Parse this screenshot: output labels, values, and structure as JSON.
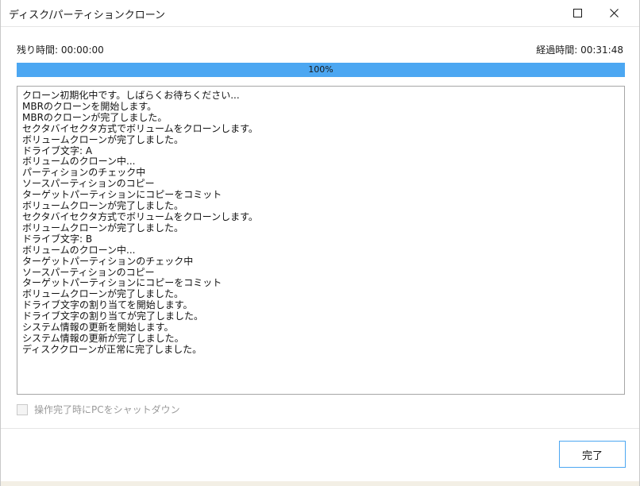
{
  "window": {
    "title": "ディスク/パーティションクローン",
    "maximize_icon": "maximize-icon",
    "close_icon": "close-icon"
  },
  "times": {
    "remaining": "残り時間:  00:00:00",
    "elapsed": "経過時間:  00:31:48"
  },
  "progress": {
    "percent": 100,
    "label": "100%",
    "color": "#4ca7f2"
  },
  "log": {
    "lines": [
      "クローン初期化中です。しばらくお待ちください...",
      "MBRのクローンを開始します。",
      "MBRのクローンが完了しました。",
      "セクタバイセクタ方式でボリュームをクローンします。",
      "ボリュームクローンが完了しました。",
      "ドライブ文字: A",
      "ボリュームのクローン中...",
      "パーティションのチェック中",
      "ソースパーティションのコピー",
      "ターゲットパーティションにコピーをコミット",
      "ボリュームクローンが完了しました。",
      "セクタバイセクタ方式でボリュームをクローンします。",
      "ボリュームクローンが完了しました。",
      "ドライブ文字: B",
      "ボリュームのクローン中...",
      "ターゲットパーティションのチェック中",
      "ソースパーティションのコピー",
      "ターゲットパーティションにコピーをコミット",
      "ボリュームクローンが完了しました。",
      "ドライブ文字の割り当てを開始します。",
      "ドライブ文字の割り当てが完了しました。",
      "システム情報の更新を開始します。",
      "システム情報の更新が完了しました。",
      "ディスククローンが正常に完了しました。"
    ]
  },
  "shutdown": {
    "label": "操作完了時にPCをシャットダウン",
    "checked": false
  },
  "footer": {
    "done_label": "完了",
    "accent": "#4ca7f2"
  }
}
